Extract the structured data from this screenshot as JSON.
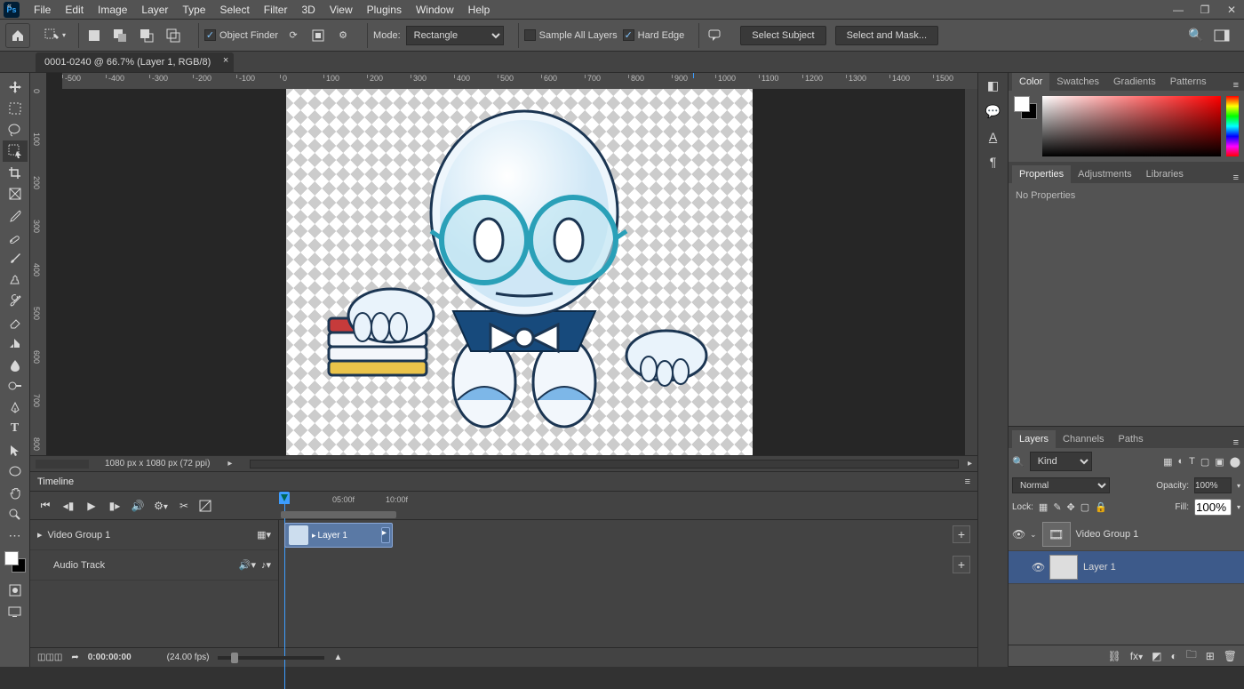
{
  "menu": [
    "File",
    "Edit",
    "Image",
    "Layer",
    "Type",
    "Select",
    "Filter",
    "3D",
    "View",
    "Plugins",
    "Window",
    "Help"
  ],
  "options_bar": {
    "mode_label": "Mode:",
    "mode_value": "Rectangle",
    "object_finder": "Object Finder",
    "sample_all": "Sample All Layers",
    "hard_edge": "Hard Edge",
    "select_subject": "Select Subject",
    "select_and_mask": "Select and Mask..."
  },
  "document": {
    "tab_title": "0001-0240 @ 66.7% (Layer 1, RGB/8)",
    "status_dimensions": "1080 px x 1080 px (72 ppi)"
  },
  "ruler_h": [
    "-500",
    "-400",
    "-300",
    "-200",
    "-100",
    "0",
    "100",
    "200",
    "300",
    "400",
    "500",
    "600",
    "700",
    "800",
    "900",
    "1000",
    "1100",
    "1200",
    "1300",
    "1400",
    "1500"
  ],
  "ruler_v": [
    "0",
    "100",
    "200",
    "300",
    "400",
    "500",
    "600",
    "700",
    "800"
  ],
  "timeline": {
    "panel_title": "Timeline",
    "time_labels": {
      "l1": "05:00f",
      "l2": "10:00f"
    },
    "video_group": "Video Group 1",
    "audio_track": "Audio Track",
    "clip_name": "Layer 1",
    "timecode": "0:00:00:00",
    "fps": "(24.00 fps)"
  },
  "panels": {
    "color_tabs": [
      "Color",
      "Swatches",
      "Gradients",
      "Patterns"
    ],
    "props_tabs": [
      "Properties",
      "Adjustments",
      "Libraries"
    ],
    "props_empty": "No Properties",
    "layers_tabs": [
      "Layers",
      "Channels",
      "Paths"
    ],
    "layers": {
      "filter_kind": "Kind",
      "blend_mode": "Normal",
      "opacity_label": "Opacity:",
      "opacity_value": "100%",
      "lock_label": "Lock:",
      "fill_label": "Fill:",
      "fill_value": "100%",
      "group_name": "Video Group 1",
      "layer_name": "Layer 1"
    }
  }
}
